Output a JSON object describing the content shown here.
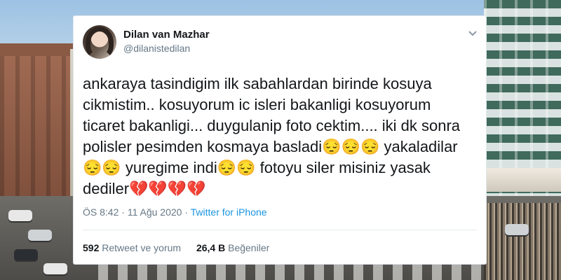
{
  "tweet": {
    "display_name": "Dilan van Mazhar",
    "handle": "@dilanistedilan",
    "text": "ankaraya tasindigim ilk sabahlardan birinde kosuya\ncikmistim.. kosuyorum ic isleri bakanligi kosuyorum\nticaret bakanligi... duygulanip foto cektim.... iki dk sonra\npolisler pesimden kosmaya basladi😔😔😔 yakaladilar\n😔😔 yuregime indi😔😔 fotoyu siler misiniz yasak\ndediler💔💔💔💔",
    "time": "ÖS 8:42",
    "separator": " · ",
    "date": "11 Ağu 2020",
    "source": "Twitter for iPhone",
    "retweets_count": "592",
    "retweets_label": "Retweet ve yorum",
    "likes_count": "26,4 B",
    "likes_label": "Beğeniler"
  },
  "icons": {
    "menu": "chevron-down-icon"
  },
  "colors": {
    "text_primary": "#14171a",
    "text_secondary": "#657786",
    "link": "#1b95e0",
    "card_bg": "#ffffff"
  }
}
